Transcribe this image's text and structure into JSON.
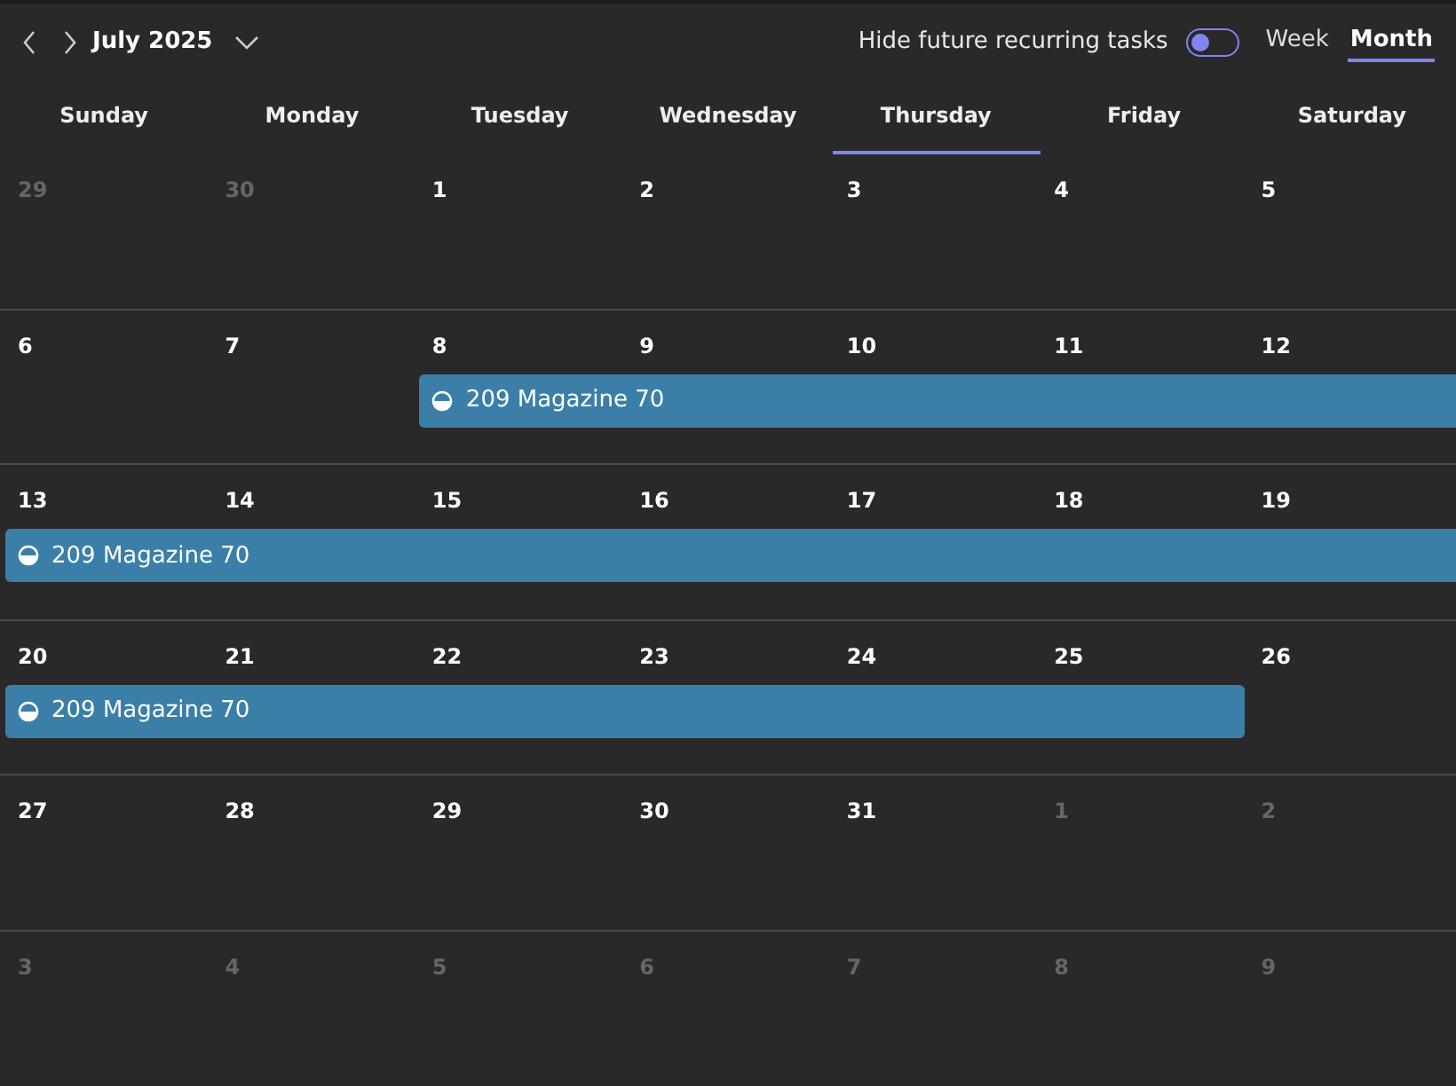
{
  "header": {
    "month": "July 2025",
    "toggle": {
      "label": "Hide future recurring tasks",
      "on": false
    },
    "views": [
      {
        "label": "Week",
        "selected": false
      },
      {
        "label": "Month",
        "selected": true
      }
    ]
  },
  "weekdays": [
    {
      "label": "Sunday",
      "selected": false
    },
    {
      "label": "Monday",
      "selected": false
    },
    {
      "label": "Tuesday",
      "selected": false
    },
    {
      "label": "Wednesday",
      "selected": false
    },
    {
      "label": "Thursday",
      "selected": true
    },
    {
      "label": "Friday",
      "selected": false
    },
    {
      "label": "Saturday",
      "selected": false
    }
  ],
  "weeks": [
    {
      "days": [
        {
          "label": "29",
          "in_month": false,
          "task": false
        },
        {
          "label": "30",
          "in_month": false,
          "task": false
        },
        {
          "label": "1",
          "in_month": true,
          "task": false
        },
        {
          "label": "2",
          "in_month": true,
          "task": false
        },
        {
          "label": "3",
          "in_month": true,
          "task": false
        },
        {
          "label": "4",
          "in_month": true,
          "task": false
        },
        {
          "label": "5",
          "in_month": true,
          "task": false
        }
      ]
    },
    {
      "task_title": "209 Magazine 70",
      "days": [
        {
          "label": "6",
          "in_month": true,
          "task": false
        },
        {
          "label": "7",
          "in_month": true,
          "task": false
        },
        {
          "label": "8",
          "in_month": true,
          "task": true
        },
        {
          "label": "9",
          "in_month": true,
          "task": true
        },
        {
          "label": "10",
          "in_month": true,
          "task": true
        },
        {
          "label": "11",
          "in_month": true,
          "task": true
        },
        {
          "label": "12",
          "in_month": true,
          "task": true
        }
      ]
    },
    {
      "task_title": "209 Magazine 70",
      "days": [
        {
          "label": "13",
          "in_month": true,
          "task": true
        },
        {
          "label": "14",
          "in_month": true,
          "task": true
        },
        {
          "label": "15",
          "in_month": true,
          "task": true
        },
        {
          "label": "16",
          "in_month": true,
          "task": true
        },
        {
          "label": "17",
          "in_month": true,
          "task": true
        },
        {
          "label": "18",
          "in_month": true,
          "task": true
        },
        {
          "label": "19",
          "in_month": true,
          "task": true
        }
      ]
    },
    {
      "task_title": "209 Magazine 70",
      "days": [
        {
          "label": "20",
          "in_month": true,
          "task": true
        },
        {
          "label": "21",
          "in_month": true,
          "task": true
        },
        {
          "label": "22",
          "in_month": true,
          "task": true
        },
        {
          "label": "23",
          "in_month": true,
          "task": true
        },
        {
          "label": "24",
          "in_month": true,
          "task": true
        },
        {
          "label": "25",
          "in_month": true,
          "task": true
        },
        {
          "label": "26",
          "in_month": true,
          "task": false
        }
      ]
    },
    {
      "days": [
        {
          "label": "27",
          "in_month": true,
          "task": false
        },
        {
          "label": "28",
          "in_month": true,
          "task": false
        },
        {
          "label": "29",
          "in_month": true,
          "task": false
        },
        {
          "label": "30",
          "in_month": true,
          "task": false
        },
        {
          "label": "31",
          "in_month": true,
          "task": false
        },
        {
          "label": "1",
          "in_month": false,
          "task": false
        },
        {
          "label": "2",
          "in_month": false,
          "task": false
        }
      ]
    },
    {
      "days": [
        {
          "label": "3",
          "in_month": false,
          "task": false
        },
        {
          "label": "4",
          "in_month": false,
          "task": false
        },
        {
          "label": "5",
          "in_month": false,
          "task": false
        },
        {
          "label": "6",
          "in_month": false,
          "task": false
        },
        {
          "label": "7",
          "in_month": false,
          "task": false
        },
        {
          "label": "8",
          "in_month": false,
          "task": false
        },
        {
          "label": "9",
          "in_month": false,
          "task": false
        }
      ]
    }
  ]
}
